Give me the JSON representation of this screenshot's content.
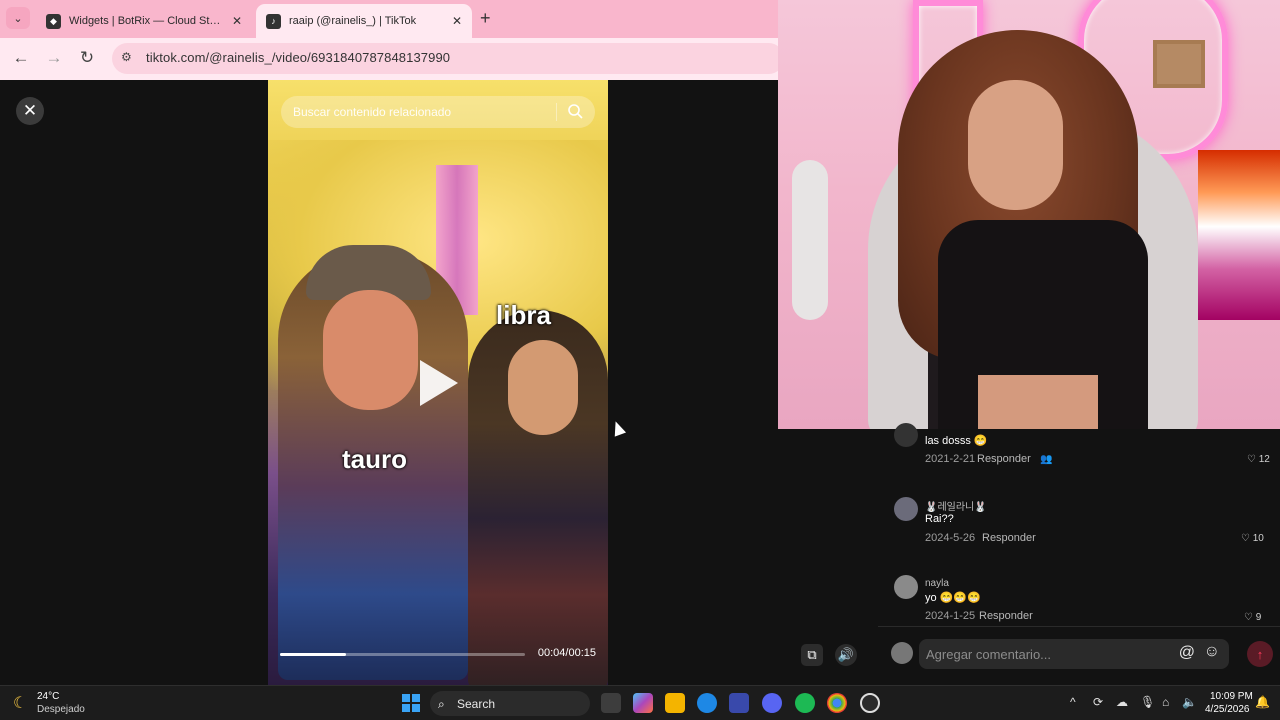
{
  "browser": {
    "tabs": [
      {
        "title": "Widgets | BotRix — Cloud Streaming Bot f",
        "active": false
      },
      {
        "title": "raaip (@rainelis_) | TikTok",
        "active": true
      }
    ],
    "url": "tiktok.com/@rainelis_/video/6931840787848137990"
  },
  "video": {
    "search_placeholder": "Buscar contenido relacionado",
    "overlay_libra": "libra",
    "overlay_tauro": "tauro",
    "progress": 0.27,
    "time": "00:04/00:15"
  },
  "comments": [
    {
      "username": "",
      "text": "las dosss 😁",
      "date": "2021-2-21",
      "reply": "Responder",
      "likes": "12"
    },
    {
      "username": "🐰레일라니🐰",
      "text": "Rai??",
      "date": "2024-5-26",
      "reply": "Responder",
      "likes": "10"
    },
    {
      "username": "nayla",
      "text": "yo 😁😁😁",
      "date": "2024-1-25",
      "reply": "Responder",
      "likes": "9"
    }
  ],
  "comment_input": {
    "placeholder": "Agregar comentario...",
    "at": "@",
    "emoji": "☺"
  },
  "taskbar": {
    "temperature": "24°C",
    "condition": "Despejado",
    "search_label": "Search",
    "time": "10:09 PM",
    "date": "4/25/2026"
  },
  "colors": {
    "tab_bar": "#f9b6cc",
    "toolbar": "#ffe9f1",
    "accent_send": "#ff3b5c"
  }
}
